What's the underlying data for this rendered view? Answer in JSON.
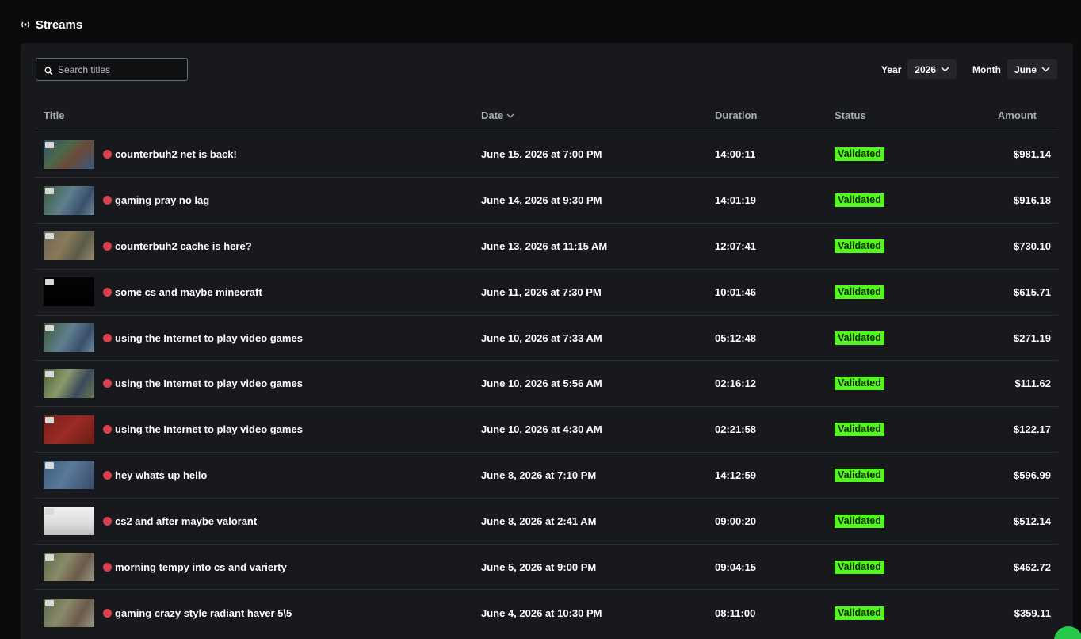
{
  "header": {
    "title": "Streams",
    "icon": "live-broadcast-icon"
  },
  "search": {
    "placeholder": "Search titles",
    "value": ""
  },
  "filters": {
    "year_label": "Year",
    "year_value": "2026",
    "month_label": "Month",
    "month_value": "June"
  },
  "columns": {
    "title": "Title",
    "date": "Date",
    "duration": "Duration",
    "status": "Status",
    "amount": "Amount"
  },
  "colors": {
    "validated": "#53f61d",
    "live_dot": "#d8414f",
    "card_bg": "#17191c"
  },
  "rows": [
    {
      "title": "counterbuh2 net is back!",
      "date": "June 15, 2026 at 7:00 PM",
      "duration": "14:00:11",
      "status": "Validated",
      "amount": "$981.14",
      "thumb": "t1"
    },
    {
      "title": "gaming pray no lag",
      "date": "June 14, 2026 at 9:30 PM",
      "duration": "14:01:19",
      "status": "Validated",
      "amount": "$916.18",
      "thumb": "t2"
    },
    {
      "title": "counterbuh2 cache is here?",
      "date": "June 13, 2026 at 11:15 AM",
      "duration": "12:07:41",
      "status": "Validated",
      "amount": "$730.10",
      "thumb": "t3"
    },
    {
      "title": "some cs and maybe minecraft",
      "date": "June 11, 2026 at 7:30 PM",
      "duration": "10:01:46",
      "status": "Validated",
      "amount": "$615.71",
      "thumb": "t4"
    },
    {
      "title": "using the Internet to play video games",
      "date": "June 10, 2026 at 7:33 AM",
      "duration": "05:12:48",
      "status": "Validated",
      "amount": "$271.19",
      "thumb": "t2"
    },
    {
      "title": "using the Internet to play video games",
      "date": "June 10, 2026 at 5:56 AM",
      "duration": "02:16:12",
      "status": "Validated",
      "amount": "$111.62",
      "thumb": "t5"
    },
    {
      "title": "using the Internet to play video games",
      "date": "June 10, 2026 at 4:30 AM",
      "duration": "02:21:58",
      "status": "Validated",
      "amount": "$122.17",
      "thumb": "t6"
    },
    {
      "title": "hey whats up hello",
      "date": "June 8, 2026 at 7:10 PM",
      "duration": "14:12:59",
      "status": "Validated",
      "amount": "$596.99",
      "thumb": "t7"
    },
    {
      "title": "cs2 and after maybe valorant",
      "date": "June 8, 2026 at 2:41 AM",
      "duration": "09:00:20",
      "status": "Validated",
      "amount": "$512.14",
      "thumb": "t8"
    },
    {
      "title": "morning tempy into cs and varierty",
      "date": "June 5, 2026 at 9:00 PM",
      "duration": "09:04:15",
      "status": "Validated",
      "amount": "$462.72",
      "thumb": "t9"
    },
    {
      "title": "gaming crazy style radiant haver 5\\5",
      "date": "June 4, 2026 at 10:30 PM",
      "duration": "08:11:00",
      "status": "Validated",
      "amount": "$359.11",
      "thumb": "t9"
    }
  ]
}
